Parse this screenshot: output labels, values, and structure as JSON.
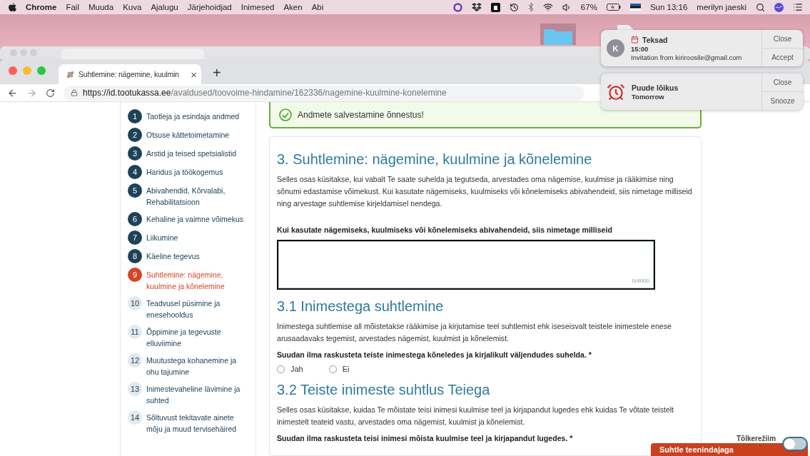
{
  "menubar": {
    "app": "Chrome",
    "menus": [
      "Fail",
      "Muuda",
      "Kuva",
      "Ajalugu",
      "Järjehoidjad",
      "Inimesed",
      "Aken",
      "Abi"
    ],
    "battery": "67%",
    "clock": "Sun 13:16",
    "user": "merilyn jaeski"
  },
  "browser": {
    "tab_title": "Suhtlemine: nägemine, kuulmin",
    "tab_close": "×",
    "new_tab": "+",
    "url_host": "https://id.tootukassa.ee",
    "url_path": "/avaldused/toovoime-hindamine/162336/nagemine-kuulmine-konelemine"
  },
  "notifications": [
    {
      "kind": "calendar",
      "avatar": "K",
      "title": "Teksad",
      "time": "15:00",
      "body": "Invitation from kiriroosile@gmail.com",
      "actions": [
        "Close",
        "Accept"
      ]
    },
    {
      "kind": "reminder",
      "title": "Puude lõikus",
      "time": "Tomorrow",
      "actions": [
        "Close",
        "Snooze"
      ]
    }
  ],
  "sidebar": {
    "steps": [
      {
        "number": "1",
        "label": "Taotleja ja esindaja andmed",
        "completed": true,
        "selected": false
      },
      {
        "number": "2",
        "label": "Otsuse kättetoimetamine",
        "completed": true,
        "selected": false
      },
      {
        "number": "3",
        "label": "Arstid ja teised spetsialistid",
        "completed": true,
        "selected": false
      },
      {
        "number": "4",
        "label": "Haridus ja töökogemus",
        "completed": true,
        "selected": false
      },
      {
        "number": "5",
        "label": "Abivahendid, Kõrvalabi, Rehabilitatsioon",
        "completed": true,
        "selected": false
      },
      {
        "number": "6",
        "label": "Kehaline ja vaimne võimekus",
        "completed": true,
        "selected": false
      },
      {
        "number": "7",
        "label": "Liikumine",
        "completed": true,
        "selected": false
      },
      {
        "number": "8",
        "label": "Käeline tegevus",
        "completed": true,
        "selected": false
      },
      {
        "number": "9",
        "label": "Suhtlemine: nägemine, kuulmine ja kõnelemine",
        "completed": false,
        "selected": true
      },
      {
        "number": "10",
        "label": "Teadvusel püsimine ja enesehooldus",
        "completed": false,
        "selected": false
      },
      {
        "number": "11",
        "label": "Õppimine ja tegevuste elluviimine",
        "completed": false,
        "selected": false
      },
      {
        "number": "12",
        "label": "Muutustega kohanemine ja ohu tajumine",
        "completed": false,
        "selected": false
      },
      {
        "number": "13",
        "label": "Inimestevaheline lävimine ja suhted",
        "completed": false,
        "selected": false
      },
      {
        "number": "14",
        "label": "Sõltuvust tekitavate ainete mõju ja muud tervisehäired",
        "completed": false,
        "selected": false
      }
    ]
  },
  "alert": {
    "text": "Andmete salvestamine õnnestus!"
  },
  "section": {
    "title": "3. Suhtlemine: nägemine, kuulmine ja kõnelemine",
    "intro": "Selles osas küsitakse, kui vabalt Te saate suhelda ja tegutseda, arvestades oma nägemise, kuulmise ja rääkimise ning sõnumi edastamise võimekust. Kui kasutate nägemiseks, kuulmiseks või kõnelemiseks abivahendeid, siis nimetage milliseid ning arvestage suhtlemise kirjeldamisel nendega.",
    "field_label": "Kui kasutate nägemiseks, kuulmiseks või kõnelemiseks abivahendeid, siis nimetage milliseid",
    "counter": "0/4000"
  },
  "subsections": [
    {
      "title": "3.1 Inimestega suhtlemine",
      "text": "Inimestega suhtlemise all mõistetakse rääkimise ja kirjutamise teel suhtlemist ehk iseseisvalt teistele inimestele enese arusaadavaks tegemist, arvestades nägemist, kuulmist ja kõnelemist.",
      "question": "Suudan ilma raskusteta teiste inimestega kõneledes ja kirjalikult väljendudes suhelda. *",
      "options": [
        {
          "label": "Jah",
          "selected": false
        },
        {
          "label": "Ei",
          "selected": false
        }
      ]
    },
    {
      "title": "3.2 Teiste inimeste suhtlus Teiega",
      "text": "Selles osas küsitakse, kuidas Te mõistate teisi inimesi kuulmise teel ja kirjapandut lugedes ehk kuidas Te võtate teistelt inimestelt teateid vastu, arvestades oma nägemist, kuulmist ja kõnelemist.",
      "question": "Suudan ilma raskusteta teisi inimesi mõista kuulmise teel ja kirjapandut lugedes. *"
    }
  ],
  "chat_button": "Suhtle teenindajaga",
  "translation_toggle": {
    "label": "Tõlkerežiim",
    "on": false
  }
}
